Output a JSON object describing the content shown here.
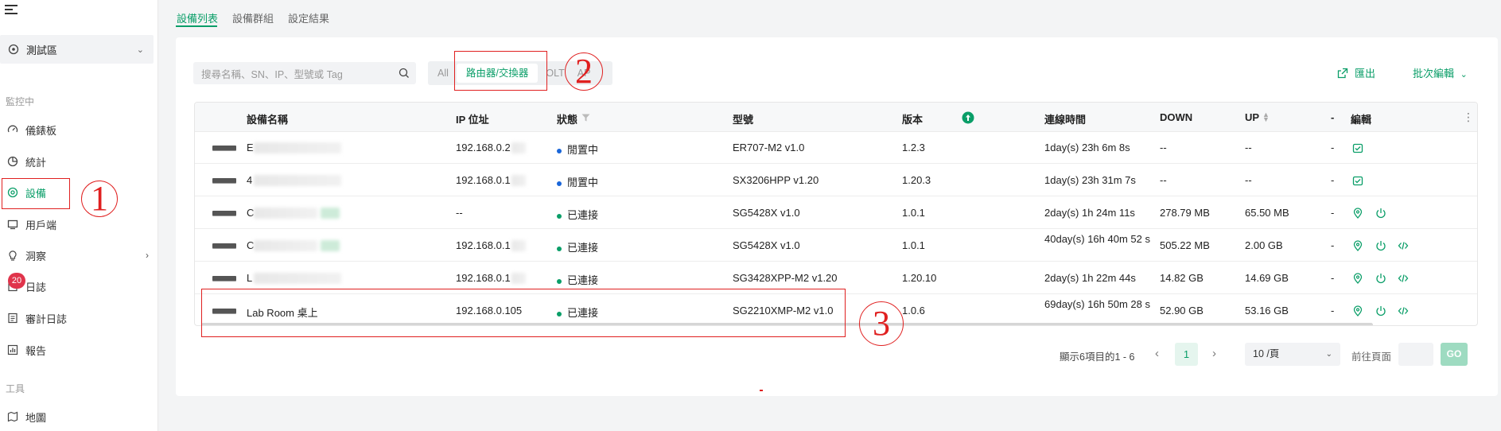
{
  "sidebar": {
    "site": "測試區",
    "section_monitor": "監控中",
    "items": [
      {
        "label": "儀錶板",
        "icon": "gauge-icon"
      },
      {
        "label": "統計",
        "icon": "pie-chart-icon"
      },
      {
        "label": "設備",
        "icon": "target-icon"
      },
      {
        "label": "用戶端",
        "icon": "client-icon"
      },
      {
        "label": "洞察",
        "icon": "bulb-icon"
      },
      {
        "label": "日誌",
        "icon": "log-icon"
      },
      {
        "label": "審計日誌",
        "icon": "audit-icon"
      },
      {
        "label": "報告",
        "icon": "report-icon"
      }
    ],
    "log_badge": "20",
    "section_tools": "工具",
    "tools": [
      {
        "label": "地圖",
        "icon": "map-icon"
      }
    ]
  },
  "tabs": [
    "設備列表",
    "設備群組",
    "設定結果"
  ],
  "search": {
    "placeholder": "搜尋名稱、SN、IP、型號或 Tag"
  },
  "filters": [
    "All",
    "路由器/交換器",
    "OLT",
    "AP"
  ],
  "actions": {
    "export": "匯出",
    "bulk_edit": "批次編輯"
  },
  "table": {
    "headers": [
      "設備名稱",
      "IP 位址",
      "狀態",
      "型號",
      "版本",
      "連線時間",
      "DOWN",
      "UP",
      "-",
      "編輯"
    ],
    "rows": [
      {
        "name": "E",
        "ip": "192.168.0.2",
        "status": "閒置中",
        "model": "ER707-M2 v1.0",
        "version": "1.2.3",
        "uptime": "1day(s) 23h 6m 8s",
        "down": "--",
        "up": "--",
        "extra": "-"
      },
      {
        "name": "4",
        "ip": "192.168.0.1",
        "status": "閒置中",
        "model": "SX3206HPP v1.20",
        "version": "1.20.3",
        "uptime": "1day(s) 23h 31m 7s",
        "down": "--",
        "up": "--",
        "extra": "-"
      },
      {
        "name": "C",
        "ip": "--",
        "status": "已連接",
        "model": "SG5428X v1.0",
        "version": "1.0.1",
        "uptime": "2day(s) 1h 24m 11s",
        "down": "278.79 MB",
        "up": "65.50 MB",
        "extra": "-"
      },
      {
        "name": "C",
        "ip": "192.168.0.1",
        "status": "已連接",
        "model": "SG5428X v1.0",
        "version": "1.0.1",
        "uptime": "40day(s) 16h 40m 52 s",
        "down": "505.22 MB",
        "up": "2.00 GB",
        "extra": "-"
      },
      {
        "name": "L",
        "ip": "192.168.0.1",
        "status": "已連接",
        "model": "SG3428XPP-M2 v1.20",
        "version": "1.20.10",
        "uptime": "2day(s) 1h 22m 44s",
        "down": "14.82 GB",
        "up": "14.69 GB",
        "extra": "-"
      },
      {
        "name": "Lab Room 桌上",
        "ip": "192.168.0.105",
        "status": "已連接",
        "model": "SG2210XMP-M2 v1.0",
        "version": "1.0.6",
        "uptime": "69day(s) 16h 50m 28 s",
        "down": "52.90 GB",
        "up": "53.16 GB",
        "extra": "-"
      }
    ]
  },
  "pagination": {
    "info": "顯示6項目的1 - 6",
    "current": "1",
    "page_size": "10 /頁",
    "goto_label": "前往頁面",
    "go": "GO"
  },
  "annotations": [
    "1",
    "2",
    "3"
  ],
  "colors": {
    "accent": "#0a9e68",
    "annotation": "#e02020",
    "idle_dot": "#1a66d9",
    "connected_dot": "#0a9e68"
  }
}
